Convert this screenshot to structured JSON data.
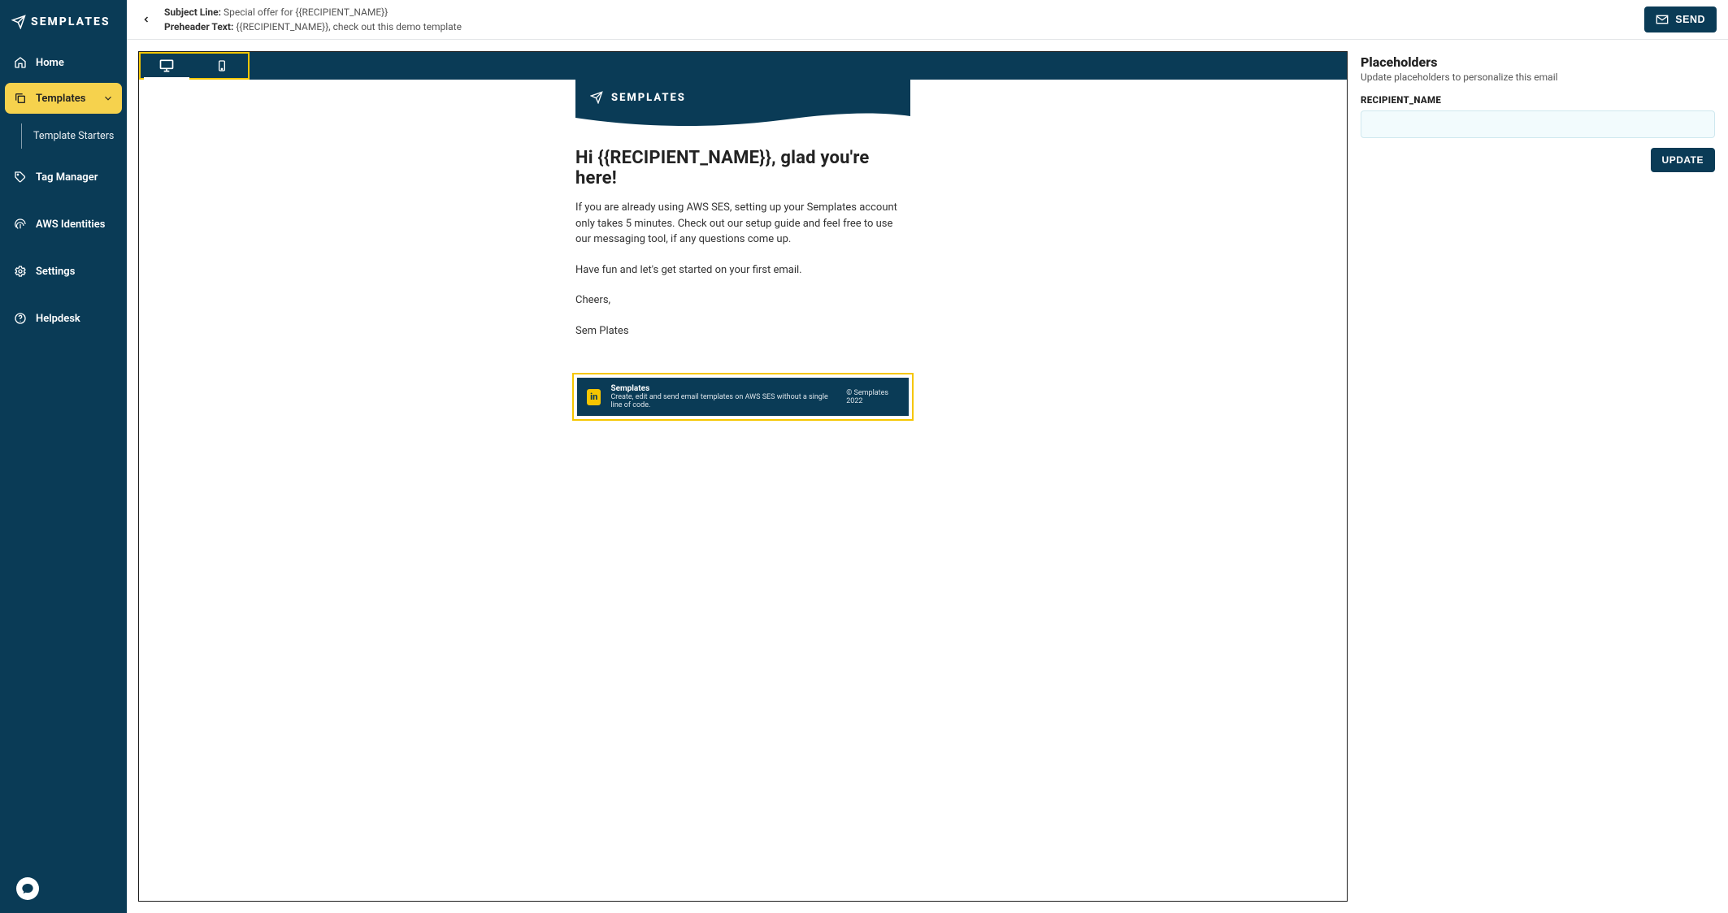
{
  "brand": {
    "name": "SEMPLATES"
  },
  "sidebar": {
    "items": [
      {
        "label": "Home"
      },
      {
        "label": "Templates"
      },
      {
        "label": "Template Starters"
      },
      {
        "label": "Tag Manager"
      },
      {
        "label": "AWS Identities"
      },
      {
        "label": "Settings"
      },
      {
        "label": "Helpdesk"
      }
    ]
  },
  "topbar": {
    "subject_label": "Subject Line:",
    "subject_value": "Special offer for {{RECIPIENT_NAME}}",
    "preheader_label": "Preheader Text:",
    "preheader_value": "{{RECIPIENT_NAME}}, check out this demo template",
    "send_label": "SEND"
  },
  "preview": {
    "header_brand": "SEMPLATES",
    "greeting": "Hi {{RECIPIENT_NAME}}, glad you're here!",
    "para1": "If you are already using AWS SES, setting up your Semplates account only takes 5 minutes. Check out our setup guide and feel free to use our messaging tool, if any questions come up.",
    "para2": "Have fun and let's get started on your first email.",
    "cheers": "Cheers,",
    "signature": "Sem Plates",
    "footer": {
      "name": "Semplates",
      "sub": "Create, edit and send email templates on AWS SES without a single line of code.",
      "copyright": "© Semplates 2022",
      "badge": "in"
    }
  },
  "placeholders": {
    "title": "Placeholders",
    "subtitle": "Update placeholders to personalize this email",
    "fields": [
      {
        "name": "RECIPIENT_NAME",
        "value": ""
      }
    ],
    "update_label": "UPDATE"
  }
}
